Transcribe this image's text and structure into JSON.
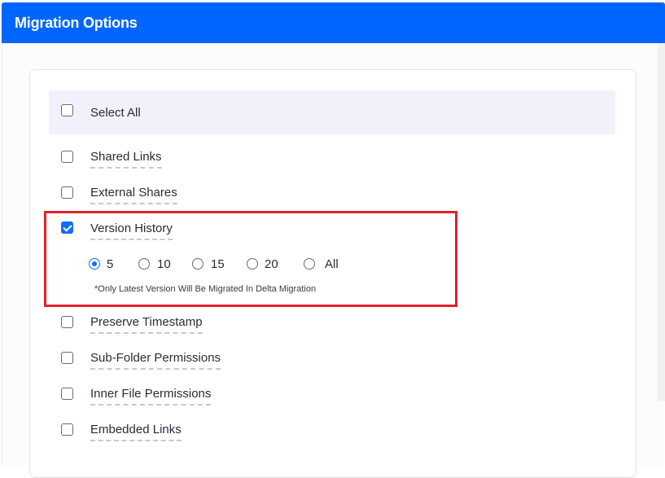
{
  "header": {
    "title": "Migration Options"
  },
  "select_all": {
    "label": "Select All",
    "checked": false
  },
  "options": [
    {
      "label": "Shared Links",
      "checked": false
    },
    {
      "label": "External Shares",
      "checked": false
    },
    {
      "label": "Version History",
      "checked": true
    },
    {
      "label": "Preserve Timestamp",
      "checked": false
    },
    {
      "label": "Sub-Folder Permissions",
      "checked": false
    },
    {
      "label": "Inner File Permissions",
      "checked": false
    },
    {
      "label": "Embedded Links",
      "checked": false
    }
  ],
  "version_history": {
    "radios": [
      {
        "label": "5",
        "selected": true
      },
      {
        "label": "10",
        "selected": false
      },
      {
        "label": "15",
        "selected": false
      },
      {
        "label": "20",
        "selected": false
      },
      {
        "label": "All",
        "selected": false
      }
    ],
    "note": "*Only Latest Version Will Be Migrated In Delta Migration"
  },
  "colors": {
    "accent": "#0066ff",
    "highlight_border": "#e3202a",
    "checkbox_checked": "#0d6efd"
  }
}
